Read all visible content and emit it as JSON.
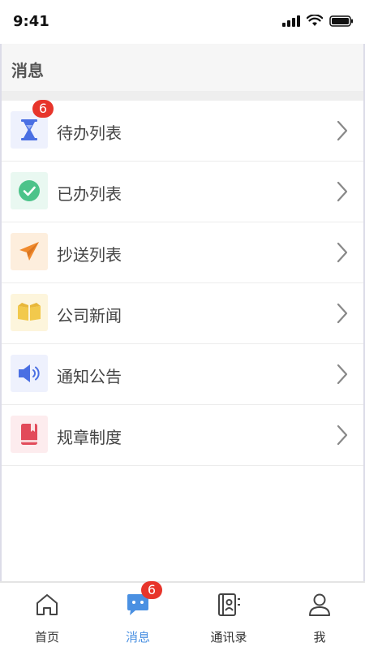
{
  "status_bar": {
    "time": "9:41"
  },
  "header": {
    "title": "消息"
  },
  "list": {
    "items": [
      {
        "label": "待办列表",
        "badge": "6"
      },
      {
        "label": "已办列表"
      },
      {
        "label": "抄送列表"
      },
      {
        "label": "公司新闻"
      },
      {
        "label": "通知公告"
      },
      {
        "label": "规章制度"
      }
    ]
  },
  "tabbar": {
    "tabs": [
      {
        "label": "首页"
      },
      {
        "label": "消息",
        "badge": "6",
        "active": true
      },
      {
        "label": "通讯录"
      },
      {
        "label": "我"
      }
    ]
  },
  "colors": {
    "accent": "#4a90e2",
    "badge": "#e7352b",
    "todo": "#4a6fe3",
    "done": "#4cc38a",
    "cc": "#f08a2c",
    "news": "#f2c94c",
    "notice": "#4a6fe3",
    "rules": "#e24b5a"
  }
}
